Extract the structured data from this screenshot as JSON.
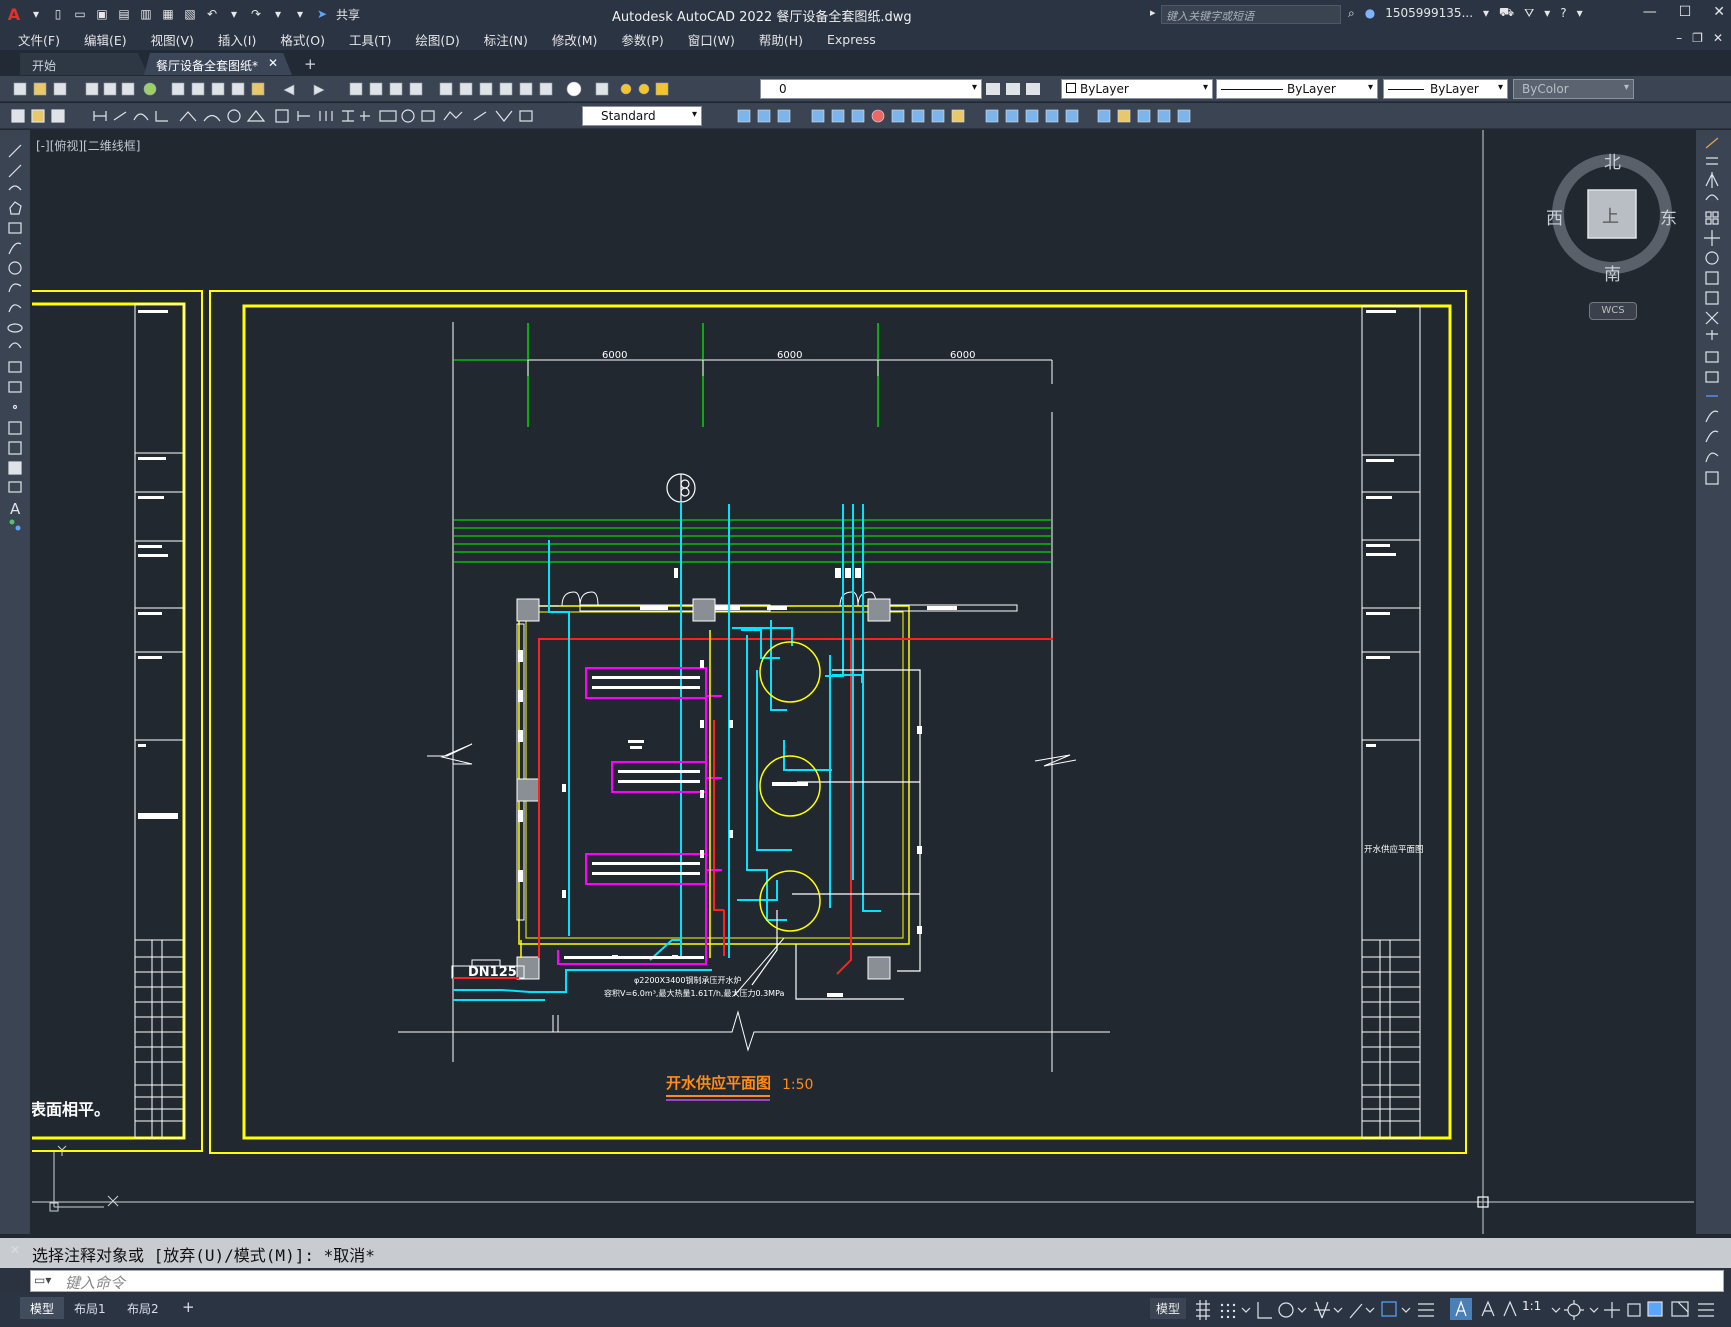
{
  "app": {
    "title": "Autodesk AutoCAD 2022    餐厅设备全套图纸.dwg",
    "search_placeholder": "键入关键字或短语",
    "user": "1505999135...",
    "share_label": "共享"
  },
  "menu": [
    "文件(F)",
    "编辑(E)",
    "视图(V)",
    "插入(I)",
    "格式(O)",
    "工具(T)",
    "绘图(D)",
    "标注(N)",
    "修改(M)",
    "参数(P)",
    "窗口(W)",
    "帮助(H)",
    "Express"
  ],
  "tabs": {
    "start": "开始",
    "drawing": "餐厅设备全套图纸*",
    "close": "✕",
    "add": "+"
  },
  "toolbar": {
    "layer_value": "0",
    "color_value": "ByLayer",
    "linetype_value": "ByLayer",
    "lineweight_value": "ByLayer",
    "plotstyle_value": "ByColor",
    "textstyle_value": "Standard"
  },
  "viewport": {
    "label": "[-][俯视][二维线框]",
    "north": "北",
    "south": "南",
    "east": "东",
    "west": "西",
    "top_face": "上",
    "wcs": "WCS"
  },
  "drawing": {
    "dim1": "6000",
    "dim2": "6000",
    "dim3": "6000",
    "pipe_label": "DN125",
    "title": "开水供应平面图",
    "scale": "1:50",
    "side_title": "开水供应平面图",
    "left_note": "表面相平。",
    "equip_note1": "φ2200X3400钢制承压开水炉",
    "equip_note2": "容积V=6.0m³,最大热量1.61T/h,最大压力0.3MPa"
  },
  "command": {
    "history": "选择注释对象或 [放弃(U)/模式(M)]: *取消*",
    "placeholder": "键入命令"
  },
  "status": {
    "model_tab": "模型",
    "layout1": "布局1",
    "layout2": "布局2",
    "add": "+",
    "model_space": "模型",
    "scale": "1:1"
  }
}
